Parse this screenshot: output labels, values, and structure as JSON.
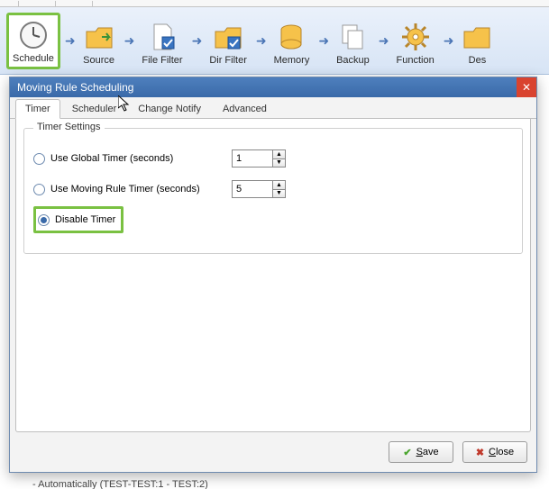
{
  "ribbon": {
    "items": [
      {
        "label": "Schedule",
        "icon": "clock",
        "selected": true
      },
      {
        "label": "Source",
        "icon": "folder-arrow"
      },
      {
        "label": "File Filter",
        "icon": "file-check"
      },
      {
        "label": "Dir Filter",
        "icon": "folder-check"
      },
      {
        "label": "Memory",
        "icon": "database"
      },
      {
        "label": "Backup",
        "icon": "copy"
      },
      {
        "label": "Function",
        "icon": "gear"
      },
      {
        "label": "Des",
        "icon": "dest",
        "cut": true
      }
    ]
  },
  "dialog": {
    "title": "Moving Rule Scheduling",
    "tabs": [
      "Timer",
      "Scheduler",
      "Change Notify",
      "Advanced"
    ],
    "active_tab": 0,
    "group_legend": "Timer Settings",
    "options": {
      "global": {
        "label": "Use Global Timer (seconds)",
        "value": "1"
      },
      "moving": {
        "label": "Use Moving Rule Timer (seconds)",
        "value": "5"
      },
      "disable": {
        "label": "Disable Timer",
        "checked": true,
        "highlighted": true
      }
    },
    "buttons": {
      "save": "Save",
      "close": "Close"
    }
  },
  "under_text": "- Automatically (TEST-TEST:1 - TEST:2)"
}
